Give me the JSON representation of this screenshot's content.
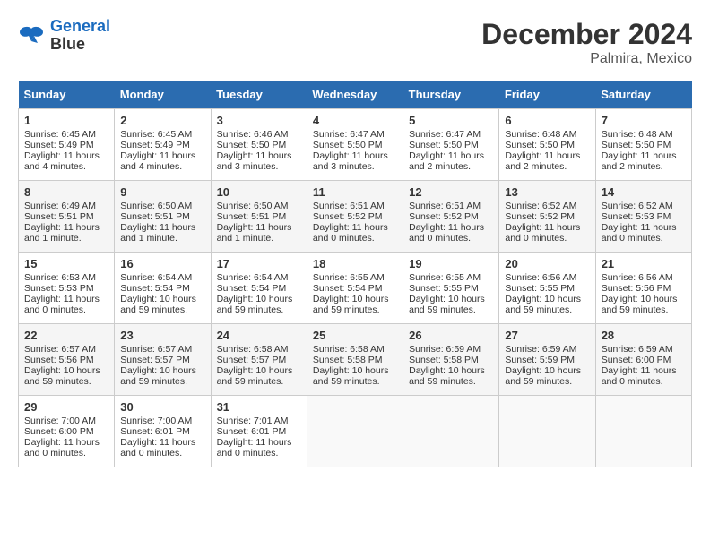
{
  "header": {
    "logo_line1": "General",
    "logo_line2": "Blue",
    "month": "December 2024",
    "location": "Palmira, Mexico"
  },
  "weekdays": [
    "Sunday",
    "Monday",
    "Tuesday",
    "Wednesday",
    "Thursday",
    "Friday",
    "Saturday"
  ],
  "weeks": [
    [
      {
        "day": "1",
        "sunrise": "Sunrise: 6:45 AM",
        "sunset": "Sunset: 5:49 PM",
        "daylight": "Daylight: 11 hours and 4 minutes."
      },
      {
        "day": "2",
        "sunrise": "Sunrise: 6:45 AM",
        "sunset": "Sunset: 5:49 PM",
        "daylight": "Daylight: 11 hours and 4 minutes."
      },
      {
        "day": "3",
        "sunrise": "Sunrise: 6:46 AM",
        "sunset": "Sunset: 5:50 PM",
        "daylight": "Daylight: 11 hours and 3 minutes."
      },
      {
        "day": "4",
        "sunrise": "Sunrise: 6:47 AM",
        "sunset": "Sunset: 5:50 PM",
        "daylight": "Daylight: 11 hours and 3 minutes."
      },
      {
        "day": "5",
        "sunrise": "Sunrise: 6:47 AM",
        "sunset": "Sunset: 5:50 PM",
        "daylight": "Daylight: 11 hours and 2 minutes."
      },
      {
        "day": "6",
        "sunrise": "Sunrise: 6:48 AM",
        "sunset": "Sunset: 5:50 PM",
        "daylight": "Daylight: 11 hours and 2 minutes."
      },
      {
        "day": "7",
        "sunrise": "Sunrise: 6:48 AM",
        "sunset": "Sunset: 5:50 PM",
        "daylight": "Daylight: 11 hours and 2 minutes."
      }
    ],
    [
      {
        "day": "8",
        "sunrise": "Sunrise: 6:49 AM",
        "sunset": "Sunset: 5:51 PM",
        "daylight": "Daylight: 11 hours and 1 minute."
      },
      {
        "day": "9",
        "sunrise": "Sunrise: 6:50 AM",
        "sunset": "Sunset: 5:51 PM",
        "daylight": "Daylight: 11 hours and 1 minute."
      },
      {
        "day": "10",
        "sunrise": "Sunrise: 6:50 AM",
        "sunset": "Sunset: 5:51 PM",
        "daylight": "Daylight: 11 hours and 1 minute."
      },
      {
        "day": "11",
        "sunrise": "Sunrise: 6:51 AM",
        "sunset": "Sunset: 5:52 PM",
        "daylight": "Daylight: 11 hours and 0 minutes."
      },
      {
        "day": "12",
        "sunrise": "Sunrise: 6:51 AM",
        "sunset": "Sunset: 5:52 PM",
        "daylight": "Daylight: 11 hours and 0 minutes."
      },
      {
        "day": "13",
        "sunrise": "Sunrise: 6:52 AM",
        "sunset": "Sunset: 5:52 PM",
        "daylight": "Daylight: 11 hours and 0 minutes."
      },
      {
        "day": "14",
        "sunrise": "Sunrise: 6:52 AM",
        "sunset": "Sunset: 5:53 PM",
        "daylight": "Daylight: 11 hours and 0 minutes."
      }
    ],
    [
      {
        "day": "15",
        "sunrise": "Sunrise: 6:53 AM",
        "sunset": "Sunset: 5:53 PM",
        "daylight": "Daylight: 11 hours and 0 minutes."
      },
      {
        "day": "16",
        "sunrise": "Sunrise: 6:54 AM",
        "sunset": "Sunset: 5:54 PM",
        "daylight": "Daylight: 10 hours and 59 minutes."
      },
      {
        "day": "17",
        "sunrise": "Sunrise: 6:54 AM",
        "sunset": "Sunset: 5:54 PM",
        "daylight": "Daylight: 10 hours and 59 minutes."
      },
      {
        "day": "18",
        "sunrise": "Sunrise: 6:55 AM",
        "sunset": "Sunset: 5:54 PM",
        "daylight": "Daylight: 10 hours and 59 minutes."
      },
      {
        "day": "19",
        "sunrise": "Sunrise: 6:55 AM",
        "sunset": "Sunset: 5:55 PM",
        "daylight": "Daylight: 10 hours and 59 minutes."
      },
      {
        "day": "20",
        "sunrise": "Sunrise: 6:56 AM",
        "sunset": "Sunset: 5:55 PM",
        "daylight": "Daylight: 10 hours and 59 minutes."
      },
      {
        "day": "21",
        "sunrise": "Sunrise: 6:56 AM",
        "sunset": "Sunset: 5:56 PM",
        "daylight": "Daylight: 10 hours and 59 minutes."
      }
    ],
    [
      {
        "day": "22",
        "sunrise": "Sunrise: 6:57 AM",
        "sunset": "Sunset: 5:56 PM",
        "daylight": "Daylight: 10 hours and 59 minutes."
      },
      {
        "day": "23",
        "sunrise": "Sunrise: 6:57 AM",
        "sunset": "Sunset: 5:57 PM",
        "daylight": "Daylight: 10 hours and 59 minutes."
      },
      {
        "day": "24",
        "sunrise": "Sunrise: 6:58 AM",
        "sunset": "Sunset: 5:57 PM",
        "daylight": "Daylight: 10 hours and 59 minutes."
      },
      {
        "day": "25",
        "sunrise": "Sunrise: 6:58 AM",
        "sunset": "Sunset: 5:58 PM",
        "daylight": "Daylight: 10 hours and 59 minutes."
      },
      {
        "day": "26",
        "sunrise": "Sunrise: 6:59 AM",
        "sunset": "Sunset: 5:58 PM",
        "daylight": "Daylight: 10 hours and 59 minutes."
      },
      {
        "day": "27",
        "sunrise": "Sunrise: 6:59 AM",
        "sunset": "Sunset: 5:59 PM",
        "daylight": "Daylight: 10 hours and 59 minutes."
      },
      {
        "day": "28",
        "sunrise": "Sunrise: 6:59 AM",
        "sunset": "Sunset: 6:00 PM",
        "daylight": "Daylight: 11 hours and 0 minutes."
      }
    ],
    [
      {
        "day": "29",
        "sunrise": "Sunrise: 7:00 AM",
        "sunset": "Sunset: 6:00 PM",
        "daylight": "Daylight: 11 hours and 0 minutes."
      },
      {
        "day": "30",
        "sunrise": "Sunrise: 7:00 AM",
        "sunset": "Sunset: 6:01 PM",
        "daylight": "Daylight: 11 hours and 0 minutes."
      },
      {
        "day": "31",
        "sunrise": "Sunrise: 7:01 AM",
        "sunset": "Sunset: 6:01 PM",
        "daylight": "Daylight: 11 hours and 0 minutes."
      },
      null,
      null,
      null,
      null
    ]
  ]
}
